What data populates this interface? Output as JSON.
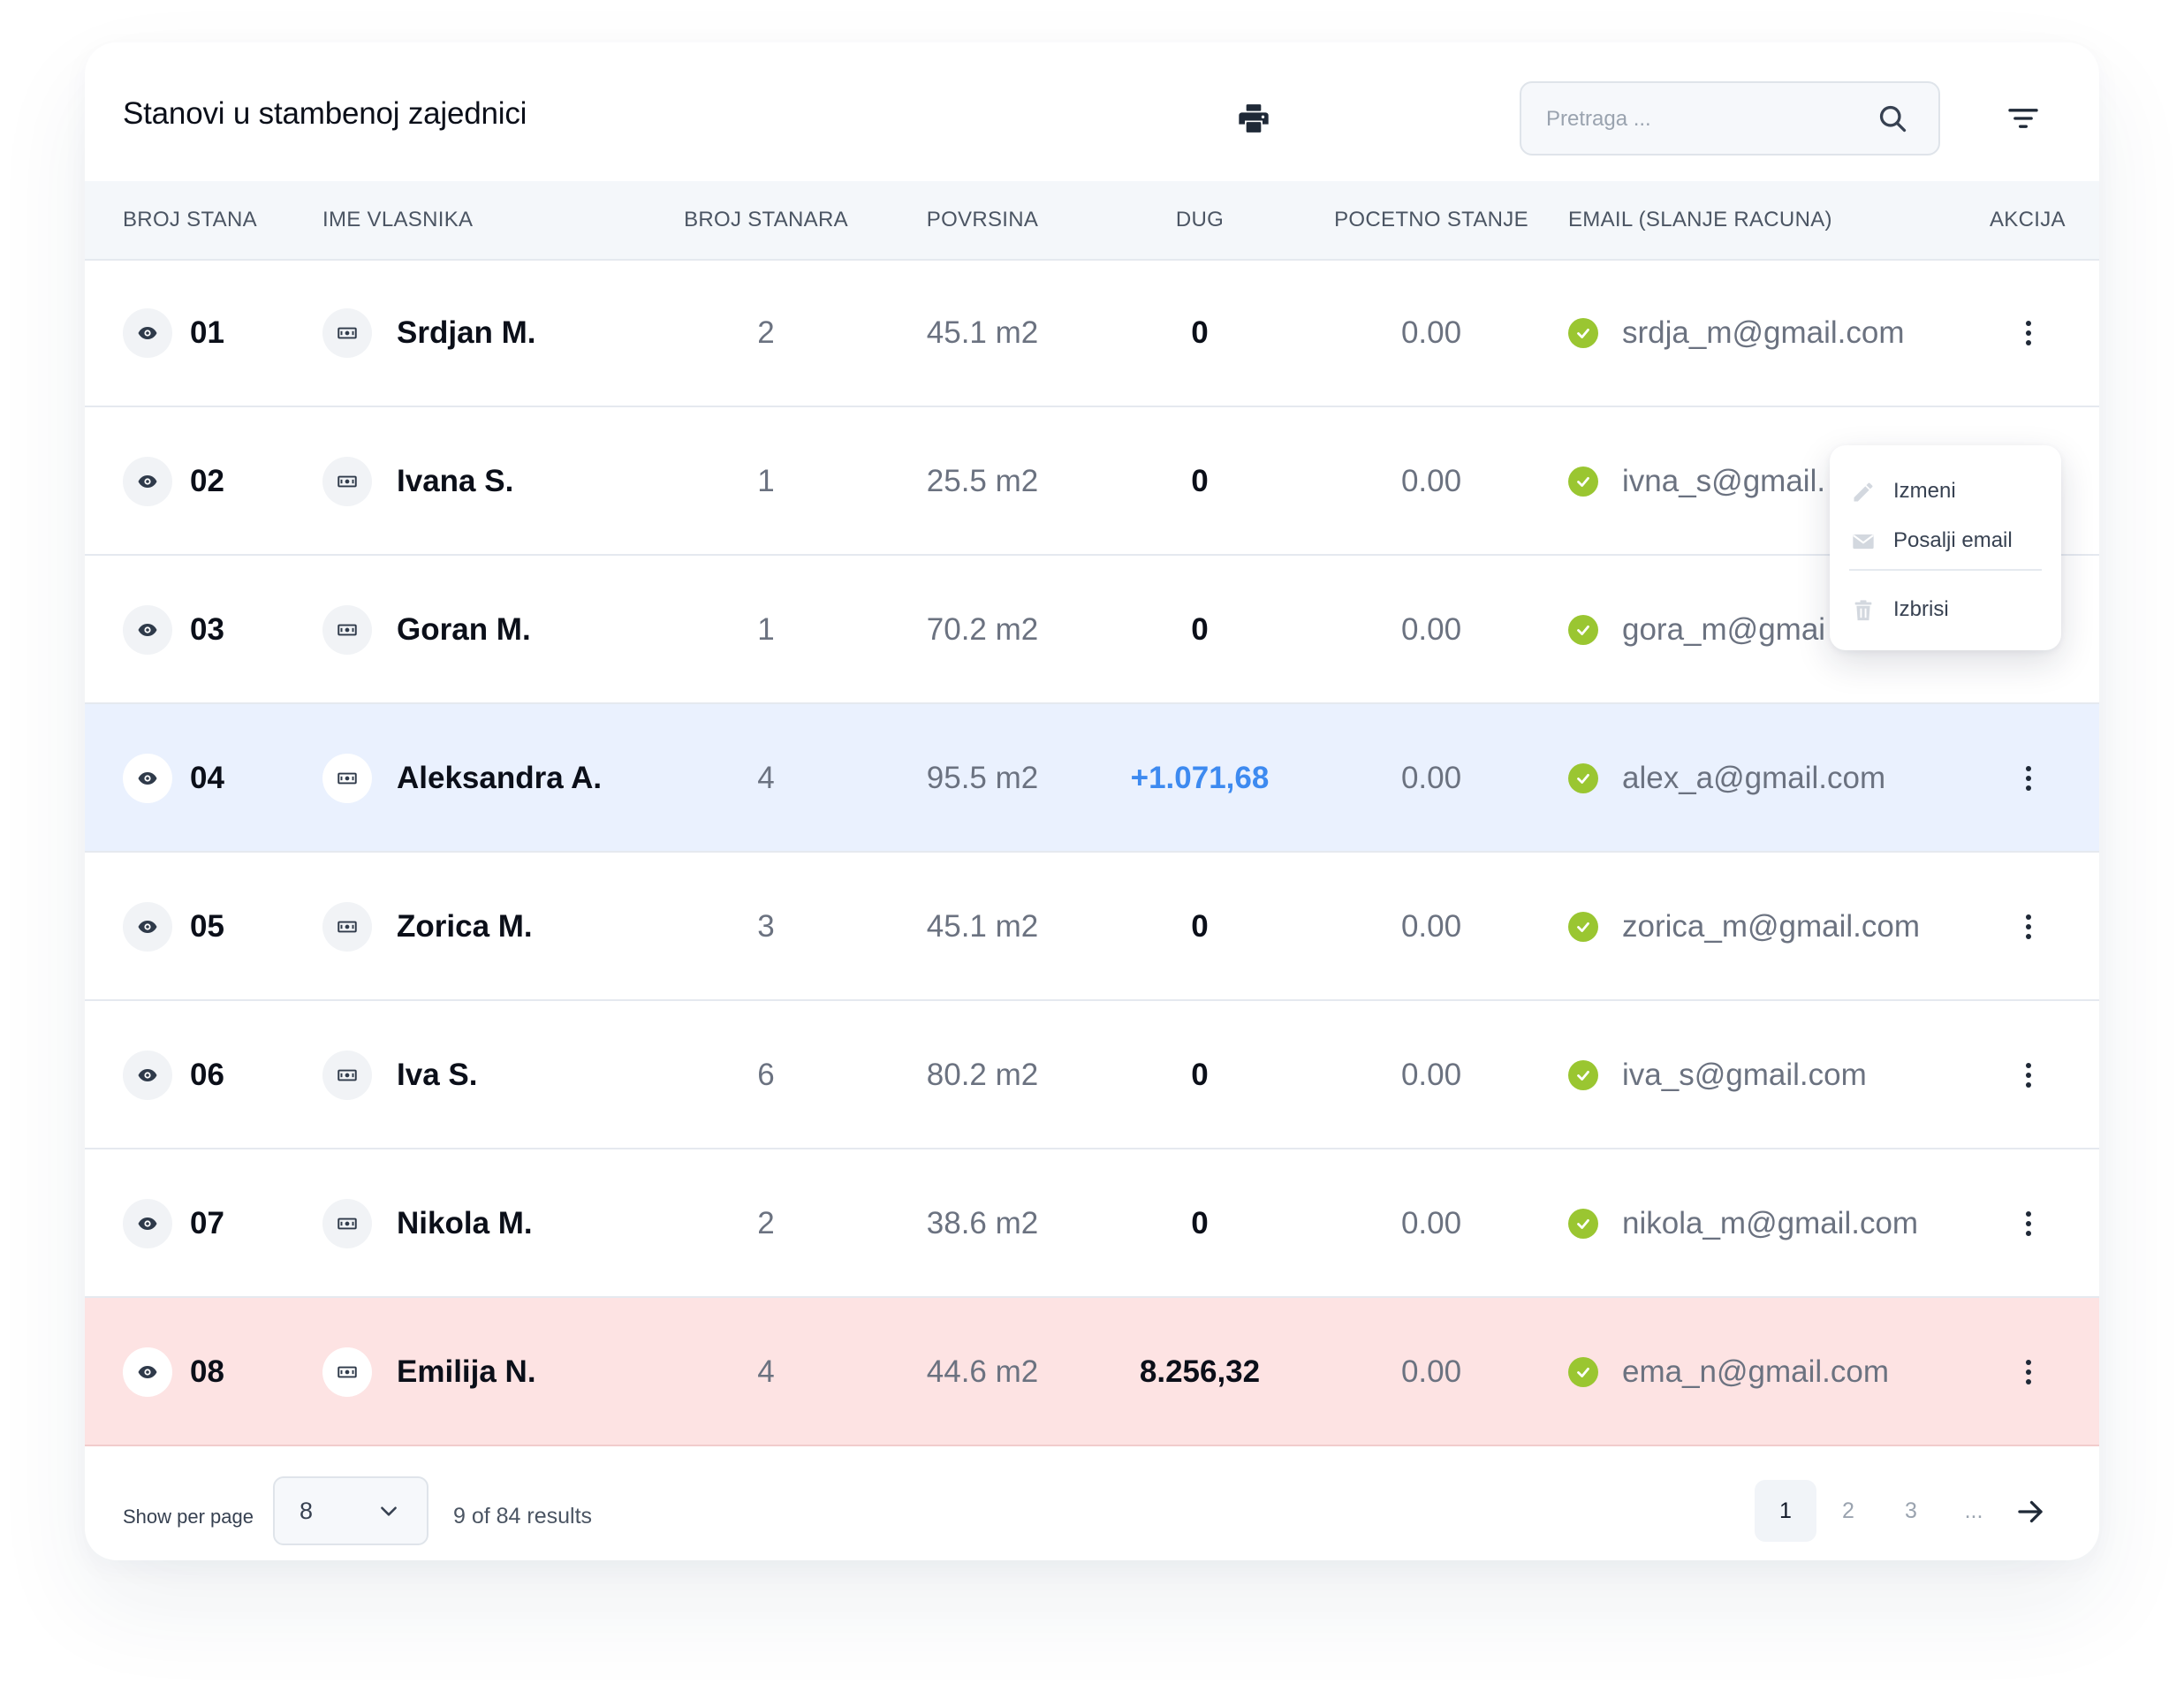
{
  "title": "Stanovi u stambenoj zajednici",
  "search": {
    "placeholder": "Pretraga ..."
  },
  "icons": {
    "search": "search-icon",
    "print": "printer-icon",
    "filter": "filter-icon",
    "view": "eye-icon",
    "owner": "banknote-icon",
    "verified": "check-circle-icon",
    "actions": "kebab-menu-icon"
  },
  "columns": {
    "num": "BROJ STANA",
    "owner": "IME VLASNIKA",
    "tenants": "BROJ STANARA",
    "area": "POVRSINA",
    "debt": "DUG",
    "balance": "POCETNO STANJE",
    "email": "EMAIL  (SLANJE RACUNA)",
    "action": "AKCIJA"
  },
  "rows": [
    {
      "num": "01",
      "owner": "Srdjan M.",
      "tenants": "2",
      "area": "45.1 m2",
      "debt": "0",
      "balance": "0.00",
      "email": "srdja_m@gmail.com"
    },
    {
      "num": "02",
      "owner": "Ivana S.",
      "tenants": "1",
      "area": "25.5 m2",
      "debt": "0",
      "balance": "0.00",
      "email": "ivna_s@gmail."
    },
    {
      "num": "03",
      "owner": "Goran M.",
      "tenants": "1",
      "area": "70.2 m2",
      "debt": "0",
      "balance": "0.00",
      "email": "gora_m@gmai"
    },
    {
      "num": "04",
      "owner": "Aleksandra A.",
      "tenants": "4",
      "area": "95.5 m2",
      "debt": "+1.071,68",
      "balance": "0.00",
      "email": "alex_a@gmail.com"
    },
    {
      "num": "05",
      "owner": "Zorica M.",
      "tenants": "3",
      "area": "45.1 m2",
      "debt": "0",
      "balance": "0.00",
      "email": "zorica_m@gmail.com"
    },
    {
      "num": "06",
      "owner": "Iva S.",
      "tenants": "6",
      "area": "80.2 m2",
      "debt": "0",
      "balance": "0.00",
      "email": "iva_s@gmail.com"
    },
    {
      "num": "07",
      "owner": "Nikola M.",
      "tenants": "2",
      "area": "38.6 m2",
      "debt": "0",
      "balance": "0.00",
      "email": "nikola_m@gmail.com"
    },
    {
      "num": "08",
      "owner": "Emilija N.",
      "tenants": "4",
      "area": "44.6 m2",
      "debt": "8.256,32",
      "balance": "0.00",
      "email": "ema_n@gmail.com"
    }
  ],
  "colors": {
    "highlight_credit": "#eaf1fe",
    "highlight_debt": "#fde3e3",
    "credit_text": "#3d8af0",
    "check_green": "#9ac631"
  },
  "context_menu": {
    "items": [
      {
        "label": "Izmeni",
        "icon": "pencil-icon"
      },
      {
        "label": "Posalji email",
        "icon": "envelope-icon"
      },
      {
        "label": "Izbrisi",
        "icon": "trash-icon"
      }
    ]
  },
  "footer": {
    "show_per_page_label": "Show per page",
    "per_page_value": "8",
    "results_text": "9 of 84 results",
    "pages": [
      "1",
      "2",
      "3",
      "..."
    ],
    "active_page": "1"
  }
}
